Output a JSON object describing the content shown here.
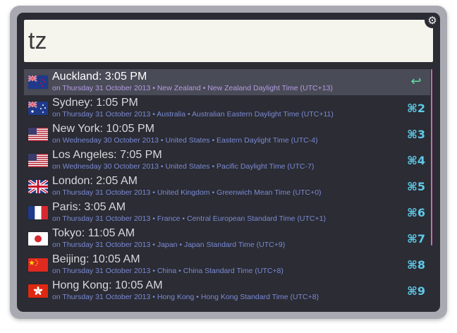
{
  "search": {
    "query": "tz"
  },
  "colors": {
    "panel": "#2b2c34",
    "selected_row": "#494b57",
    "subtitle": "#7b8ad3",
    "selected_subtitle": "#b49ce0",
    "shortcut": "#5fc9e8",
    "return_glyph": "#5fe0a0",
    "scrollbar": "#c76bb9"
  },
  "settings_icon": "gear-icon",
  "results": [
    {
      "flag": "new-zealand-flag-icon",
      "title": "Auckland: 3:05 PM",
      "subtitle": "on Thursday 31 October 2013  •  New Zealand • New Zealand Daylight Time (UTC+13)",
      "shortcut": "↩"
    },
    {
      "flag": "australia-flag-icon",
      "title": "Sydney: 1:05 PM",
      "subtitle": "on Thursday 31 October 2013  •  Australia • Australian Eastern Daylight Time (UTC+11)",
      "shortcut": "⌘2"
    },
    {
      "flag": "united-states-flag-icon",
      "title": "New York: 10:05 PM",
      "subtitle": "on Wednesday 30 October 2013  •  United States • Eastern Daylight Time (UTC-4)",
      "shortcut": "⌘3"
    },
    {
      "flag": "united-states-flag-icon",
      "title": "Los Angeles: 7:05 PM",
      "subtitle": "on Wednesday 30 October 2013  •  United States • Pacific Daylight Time (UTC-7)",
      "shortcut": "⌘4"
    },
    {
      "flag": "united-kingdom-flag-icon",
      "title": "London: 2:05 AM",
      "subtitle": "on Thursday 31 October 2013  •  United Kingdom • Greenwich Mean Time (UTC+0)",
      "shortcut": "⌘5"
    },
    {
      "flag": "france-flag-icon",
      "title": "Paris: 3:05 AM",
      "subtitle": "on Thursday 31 October 2013  •  France • Central European Standard Time (UTC+1)",
      "shortcut": "⌘6"
    },
    {
      "flag": "japan-flag-icon",
      "title": "Tokyo: 11:05 AM",
      "subtitle": "on Thursday 31 October 2013  •  Japan • Japan Standard Time (UTC+9)",
      "shortcut": "⌘7"
    },
    {
      "flag": "china-flag-icon",
      "title": "Beijing: 10:05 AM",
      "subtitle": "on Thursday 31 October 2013  •  China • China Standard Time (UTC+8)",
      "shortcut": "⌘8"
    },
    {
      "flag": "hong-kong-flag-icon",
      "title": "Hong Kong: 10:05 AM",
      "subtitle": "on Thursday 31 October 2013  •  Hong Kong • Hong Kong Standard Time (UTC+8)",
      "shortcut": "⌘9"
    }
  ]
}
